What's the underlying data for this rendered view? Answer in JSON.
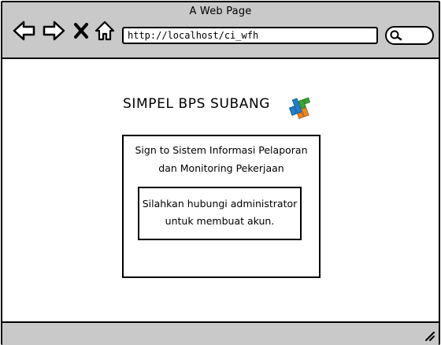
{
  "window": {
    "title": "A Web Page"
  },
  "toolbar": {
    "icons": [
      "back-arrow-icon",
      "forward-arrow-icon",
      "close-x-icon",
      "home-icon"
    ],
    "url": "http://localhost/ci_wfh",
    "search_icon": "search-icon"
  },
  "page": {
    "app_title": "SIMPEL BPS SUBANG",
    "logo": "bps-logo",
    "panel_heading_line1": "Sign to Sistem Informasi Pelaporan",
    "panel_heading_line2": "dan Monitoring Pekerjaan",
    "notice_line1": "Silahkan hubungi administrator",
    "notice_line2": "untuk membuat akun."
  },
  "colors": {
    "chrome": "#c9c9c9",
    "logo_blue": "#1e7fd0",
    "logo_green": "#3aa834",
    "logo_orange": "#f08a1c"
  }
}
